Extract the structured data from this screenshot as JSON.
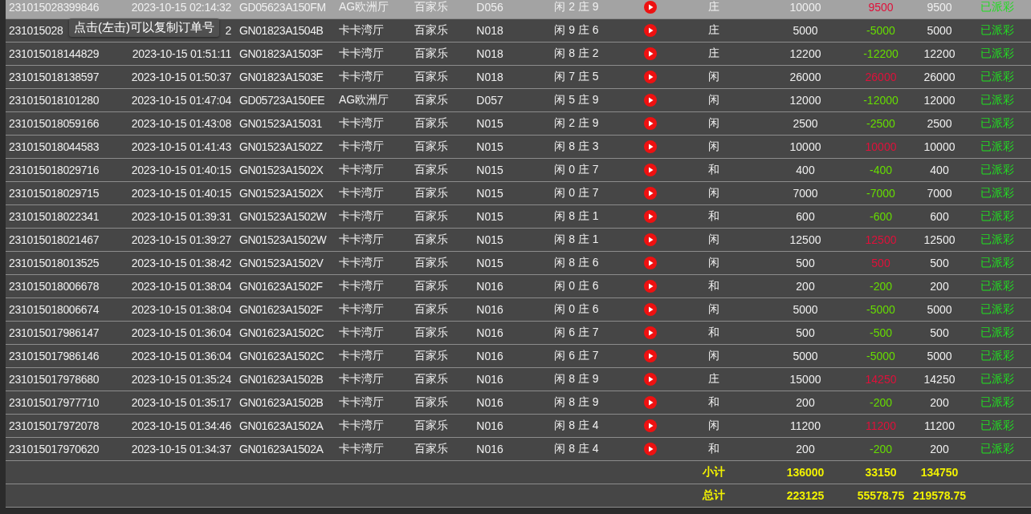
{
  "tooltip": "点击(左击)可以复制订单号",
  "rows": [
    {
      "order_id": "231015028399846",
      "time": "2023-10-15 02:14:32",
      "code": "GD05623A150FM",
      "hall": "AG欧洲厅",
      "game": "百家乐",
      "table": "D056",
      "result": "闲 2 庄 9",
      "side": "庄",
      "bet": "10000",
      "profit": "9500",
      "color": "#e0103a",
      "payout": "9500",
      "status": "已派彩",
      "selected": true
    },
    {
      "order_id": "231015028",
      "time": "2",
      "code": "GN01823A1504B",
      "hall": "卡卡湾厅",
      "game": "百家乐",
      "table": "N018",
      "result": "闲 9 庄 6",
      "side": "庄",
      "bet": "5000",
      "profit": "-5000",
      "color": "#66dd00",
      "payout": "5000",
      "status": "已派彩",
      "selected": false
    },
    {
      "order_id": "231015018144829",
      "time": "2023-10-15 01:51:11",
      "code": "GN01823A1503F",
      "hall": "卡卡湾厅",
      "game": "百家乐",
      "table": "N018",
      "result": "闲 8 庄 2",
      "side": "庄",
      "bet": "12200",
      "profit": "-12200",
      "color": "#66dd00",
      "payout": "12200",
      "status": "已派彩",
      "selected": false
    },
    {
      "order_id": "231015018138597",
      "time": "2023-10-15 01:50:37",
      "code": "GN01823A1503E",
      "hall": "卡卡湾厅",
      "game": "百家乐",
      "table": "N018",
      "result": "闲 7 庄 5",
      "side": "闲",
      "bet": "26000",
      "profit": "26000",
      "color": "#e0103a",
      "payout": "26000",
      "status": "已派彩",
      "selected": false
    },
    {
      "order_id": "231015018101280",
      "time": "2023-10-15 01:47:04",
      "code": "GD05723A150EE",
      "hall": "AG欧洲厅",
      "game": "百家乐",
      "table": "D057",
      "result": "闲 5 庄 9",
      "side": "闲",
      "bet": "12000",
      "profit": "-12000",
      "color": "#66dd00",
      "payout": "12000",
      "status": "已派彩",
      "selected": false
    },
    {
      "order_id": "231015018059166",
      "time": "2023-10-15 01:43:08",
      "code": "GN01523A15031",
      "hall": "卡卡湾厅",
      "game": "百家乐",
      "table": "N015",
      "result": "闲 2 庄 9",
      "side": "闲",
      "bet": "2500",
      "profit": "-2500",
      "color": "#66dd00",
      "payout": "2500",
      "status": "已派彩",
      "selected": false
    },
    {
      "order_id": "231015018044583",
      "time": "2023-10-15 01:41:43",
      "code": "GN01523A1502Z",
      "hall": "卡卡湾厅",
      "game": "百家乐",
      "table": "N015",
      "result": "闲 8 庄 3",
      "side": "闲",
      "bet": "10000",
      "profit": "10000",
      "color": "#e0103a",
      "payout": "10000",
      "status": "已派彩",
      "selected": false
    },
    {
      "order_id": "231015018029716",
      "time": "2023-10-15 01:40:15",
      "code": "GN01523A1502X",
      "hall": "卡卡湾厅",
      "game": "百家乐",
      "table": "N015",
      "result": "闲 0 庄 7",
      "side": "和",
      "bet": "400",
      "profit": "-400",
      "color": "#66dd00",
      "payout": "400",
      "status": "已派彩",
      "selected": false
    },
    {
      "order_id": "231015018029715",
      "time": "2023-10-15 01:40:15",
      "code": "GN01523A1502X",
      "hall": "卡卡湾厅",
      "game": "百家乐",
      "table": "N015",
      "result": "闲 0 庄 7",
      "side": "闲",
      "bet": "7000",
      "profit": "-7000",
      "color": "#66dd00",
      "payout": "7000",
      "status": "已派彩",
      "selected": false
    },
    {
      "order_id": "231015018022341",
      "time": "2023-10-15 01:39:31",
      "code": "GN01523A1502W",
      "hall": "卡卡湾厅",
      "game": "百家乐",
      "table": "N015",
      "result": "闲 8 庄 1",
      "side": "和",
      "bet": "600",
      "profit": "-600",
      "color": "#66dd00",
      "payout": "600",
      "status": "已派彩",
      "selected": false
    },
    {
      "order_id": "231015018021467",
      "time": "2023-10-15 01:39:27",
      "code": "GN01523A1502W",
      "hall": "卡卡湾厅",
      "game": "百家乐",
      "table": "N015",
      "result": "闲 8 庄 1",
      "side": "闲",
      "bet": "12500",
      "profit": "12500",
      "color": "#e0103a",
      "payout": "12500",
      "status": "已派彩",
      "selected": false
    },
    {
      "order_id": "231015018013525",
      "time": "2023-10-15 01:38:42",
      "code": "GN01523A1502V",
      "hall": "卡卡湾厅",
      "game": "百家乐",
      "table": "N015",
      "result": "闲 8 庄 6",
      "side": "闲",
      "bet": "500",
      "profit": "500",
      "color": "#e0103a",
      "payout": "500",
      "status": "已派彩",
      "selected": false
    },
    {
      "order_id": "231015018006678",
      "time": "2023-10-15 01:38:04",
      "code": "GN01623A1502F",
      "hall": "卡卡湾厅",
      "game": "百家乐",
      "table": "N016",
      "result": "闲 0 庄 6",
      "side": "和",
      "bet": "200",
      "profit": "-200",
      "color": "#66dd00",
      "payout": "200",
      "status": "已派彩",
      "selected": false
    },
    {
      "order_id": "231015018006674",
      "time": "2023-10-15 01:38:04",
      "code": "GN01623A1502F",
      "hall": "卡卡湾厅",
      "game": "百家乐",
      "table": "N016",
      "result": "闲 0 庄 6",
      "side": "闲",
      "bet": "5000",
      "profit": "-5000",
      "color": "#66dd00",
      "payout": "5000",
      "status": "已派彩",
      "selected": false
    },
    {
      "order_id": "231015017986147",
      "time": "2023-10-15 01:36:04",
      "code": "GN01623A1502C",
      "hall": "卡卡湾厅",
      "game": "百家乐",
      "table": "N016",
      "result": "闲 6 庄 7",
      "side": "和",
      "bet": "500",
      "profit": "-500",
      "color": "#66dd00",
      "payout": "500",
      "status": "已派彩",
      "selected": false
    },
    {
      "order_id": "231015017986146",
      "time": "2023-10-15 01:36:04",
      "code": "GN01623A1502C",
      "hall": "卡卡湾厅",
      "game": "百家乐",
      "table": "N016",
      "result": "闲 6 庄 7",
      "side": "闲",
      "bet": "5000",
      "profit": "-5000",
      "color": "#66dd00",
      "payout": "5000",
      "status": "已派彩",
      "selected": false
    },
    {
      "order_id": "231015017978680",
      "time": "2023-10-15 01:35:24",
      "code": "GN01623A1502B",
      "hall": "卡卡湾厅",
      "game": "百家乐",
      "table": "N016",
      "result": "闲 8 庄 9",
      "side": "庄",
      "bet": "15000",
      "profit": "14250",
      "color": "#e0103a",
      "payout": "14250",
      "status": "已派彩",
      "selected": false
    },
    {
      "order_id": "231015017977710",
      "time": "2023-10-15 01:35:17",
      "code": "GN01623A1502B",
      "hall": "卡卡湾厅",
      "game": "百家乐",
      "table": "N016",
      "result": "闲 8 庄 9",
      "side": "和",
      "bet": "200",
      "profit": "-200",
      "color": "#66dd00",
      "payout": "200",
      "status": "已派彩",
      "selected": false
    },
    {
      "order_id": "231015017972078",
      "time": "2023-10-15 01:34:46",
      "code": "GN01623A1502A",
      "hall": "卡卡湾厅",
      "game": "百家乐",
      "table": "N016",
      "result": "闲 8 庄 4",
      "side": "闲",
      "bet": "11200",
      "profit": "11200",
      "color": "#e0103a",
      "payout": "11200",
      "status": "已派彩",
      "selected": false
    },
    {
      "order_id": "231015017970620",
      "time": "2023-10-15 01:34:37",
      "code": "GN01623A1502A",
      "hall": "卡卡湾厅",
      "game": "百家乐",
      "table": "N016",
      "result": "闲 8 庄 4",
      "side": "和",
      "bet": "200",
      "profit": "-200",
      "color": "#66dd00",
      "payout": "200",
      "status": "已派彩",
      "selected": false
    }
  ],
  "totals": [
    {
      "label": "小计",
      "bet": "136000",
      "profit": "33150",
      "payout": "134750"
    },
    {
      "label": "总计",
      "bet": "223125",
      "profit": "55578.75",
      "payout": "219578.75"
    }
  ]
}
